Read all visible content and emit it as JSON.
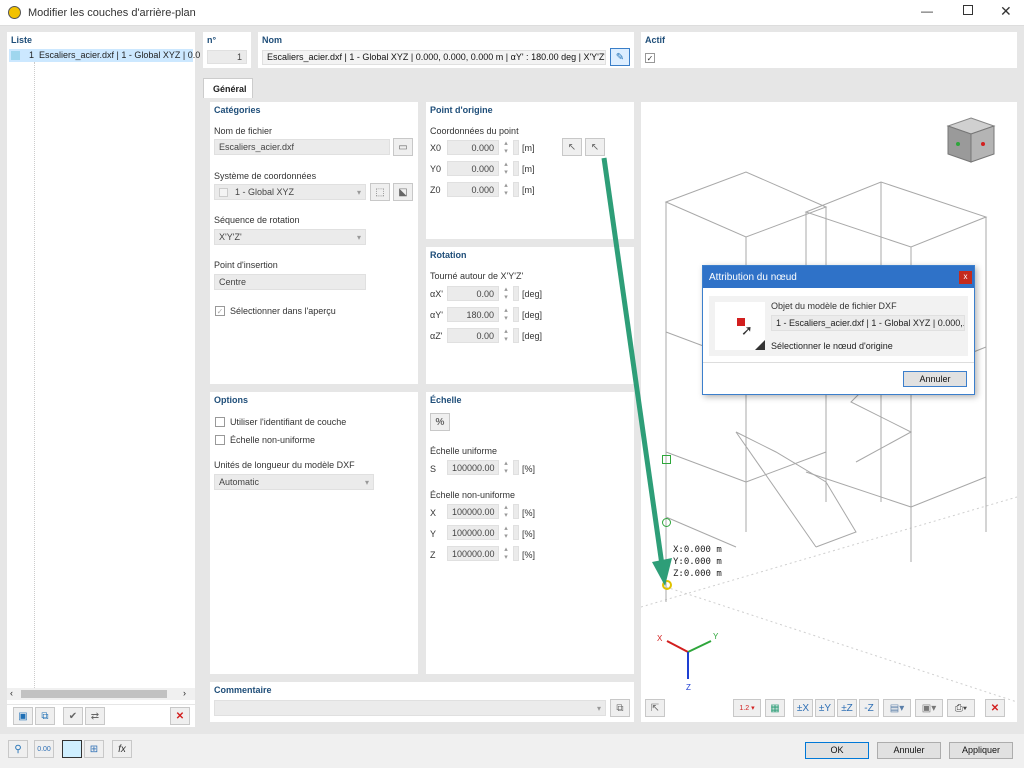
{
  "window": {
    "title": "Modifier les couches d'arrière-plan"
  },
  "list": {
    "header": "Liste",
    "items": [
      {
        "num": "1",
        "label": "Escaliers_acier.dxf | 1 - Global XYZ | 0.0"
      }
    ]
  },
  "top": {
    "num_label": "n°",
    "num_value": "1",
    "name_label": "Nom",
    "name_value": "Escaliers_acier.dxf | 1 - Global XYZ | 0.000, 0.000, 0.000 m | αY' : 180.00 deg | X'Y'Z'",
    "active_label": "Actif"
  },
  "tabs": {
    "general": "Général"
  },
  "categories": {
    "header": "Catégories",
    "filename_label": "Nom de fichier",
    "filename_value": "Escaliers_acier.dxf",
    "coord_label": "Système de coordonnées",
    "coord_value": "1 - Global XYZ",
    "rotation_seq_label": "Séquence de rotation",
    "rotation_seq_value": "X'Y'Z'",
    "insertion_label": "Point d'insertion",
    "insertion_value": "Centre",
    "select_preview": "Sélectionner dans l'aperçu"
  },
  "origin": {
    "header": "Point d'origine",
    "coords_label": "Coordonnées du point",
    "rows": [
      {
        "axis": "X0",
        "value": "0.000",
        "unit": "[m]"
      },
      {
        "axis": "Y0",
        "value": "0.000",
        "unit": "[m]"
      },
      {
        "axis": "Z0",
        "value": "0.000",
        "unit": "[m]"
      }
    ]
  },
  "rotation": {
    "header": "Rotation",
    "about_label": "Tourné autour de X'Y'Z'",
    "rows": [
      {
        "axis": "αX'",
        "value": "0.00",
        "unit": "[deg]"
      },
      {
        "axis": "αY'",
        "value": "180.00",
        "unit": "[deg]"
      },
      {
        "axis": "αZ'",
        "value": "0.00",
        "unit": "[deg]"
      }
    ]
  },
  "options": {
    "header": "Options",
    "use_layer_id": "Utiliser l'identifiant de couche",
    "non_uniform": "Échelle non-uniforme",
    "units_label": "Unités de longueur du modèle DXF",
    "units_value": "Automatic"
  },
  "scale": {
    "header": "Échelle",
    "percent_icon": "%",
    "uniform_label": "Échelle uniforme",
    "uniform": {
      "axis": "S",
      "value": "100000.00",
      "unit": "[%]"
    },
    "nonuniform_label": "Échelle non-uniforme",
    "rows": [
      {
        "axis": "X",
        "value": "100000.00",
        "unit": "[%]"
      },
      {
        "axis": "Y",
        "value": "100000.00",
        "unit": "[%]"
      },
      {
        "axis": "Z",
        "value": "100000.00",
        "unit": "[%]"
      }
    ]
  },
  "comment": {
    "header": "Commentaire",
    "value": ""
  },
  "dialog": {
    "title": "Attribution du nœud",
    "object_label": "Objet du modèle de fichier DXF",
    "object_value": "1 - Escaliers_acier.dxf | 1 - Global XYZ | 0.000,...",
    "select_origin": "Sélectionner le nœud d'origine",
    "cancel": "Annuler"
  },
  "viewport": {
    "coord_x": "X:0.000 m",
    "coord_y": "Y:0.000 m",
    "coord_z": "Z:0.000 m",
    "axis_x": "X",
    "axis_y": "Y",
    "axis_z": "Z"
  },
  "footer": {
    "ok": "OK",
    "cancel": "Annuler",
    "apply": "Appliquer"
  },
  "colors": {
    "accent": "#0078d7",
    "arrow": "#2e9e78",
    "header_text": "#1f4e79",
    "close": "#c42b1c"
  }
}
